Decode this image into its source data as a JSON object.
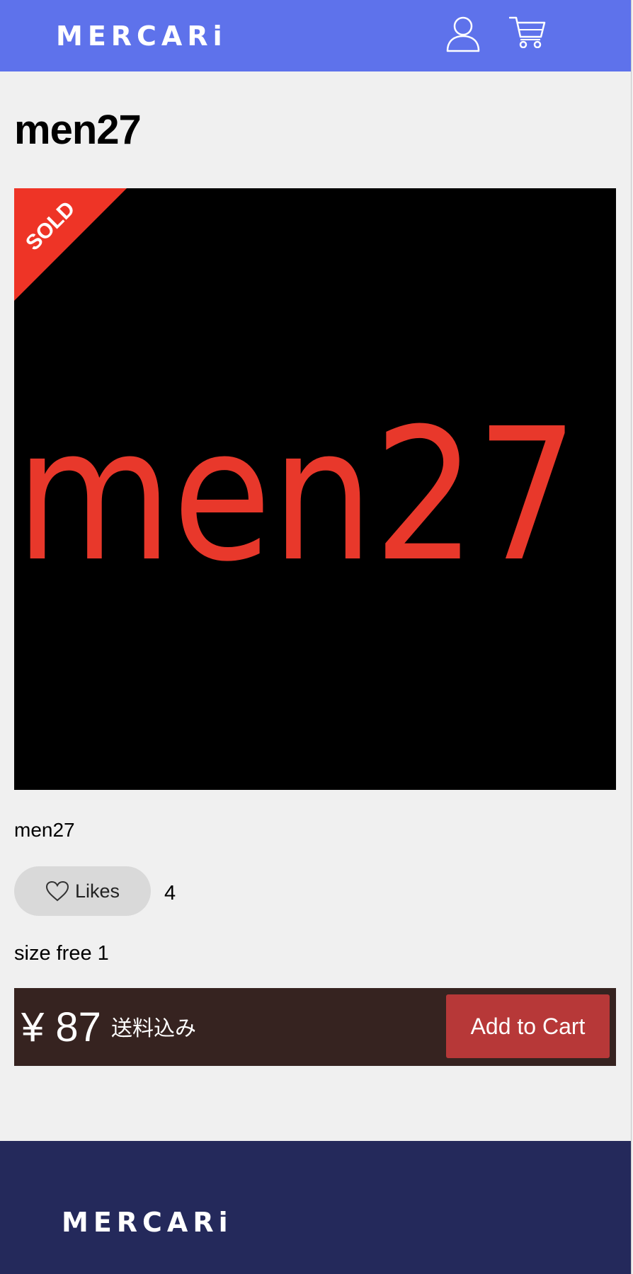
{
  "header": {
    "logo_text": "MERCARi",
    "user_icon": "user-icon",
    "cart_icon": "cart-icon",
    "background_color": "#5e72eb"
  },
  "product": {
    "title": "men27",
    "image_text": "men27",
    "sold_label": "SOLD",
    "name": "men27",
    "likes_label": "Likes",
    "likes_count": "4",
    "size": "size free 1",
    "price": "¥ 87",
    "price_note": "送料込み",
    "add_to_cart_label": "Add to Cart"
  },
  "colors": {
    "sold_ribbon": "#ee3426",
    "image_text": "#e8382b",
    "purchase_bar": "#362320",
    "add_to_cart": "#b73838",
    "footer": "#24295b"
  },
  "footer": {
    "logo_text": "MERCARi"
  }
}
